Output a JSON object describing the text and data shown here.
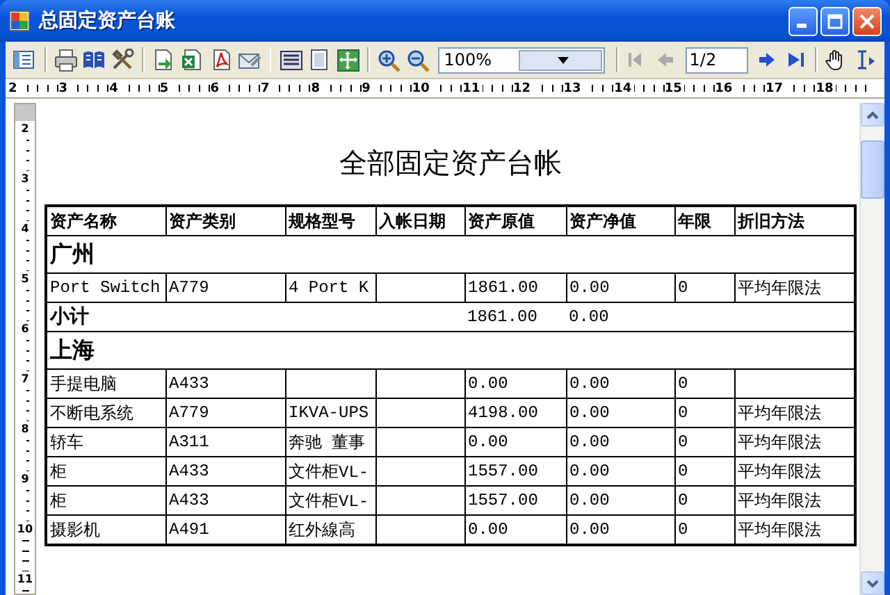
{
  "window": {
    "title": "总固定资产台账"
  },
  "toolbar": {
    "zoom": "100%",
    "page": "1/2"
  },
  "ruler": {
    "horizontal": [
      "2",
      "3",
      "4",
      "5",
      "6",
      "7",
      "8",
      "9",
      "10",
      "11",
      "12",
      "13",
      "14",
      "15",
      "16",
      "17",
      "18"
    ],
    "vertical": [
      "2",
      "3",
      "4",
      "5",
      "6",
      "7",
      "8",
      "9",
      "10",
      "11"
    ]
  },
  "report": {
    "title": "全部固定资产台帐",
    "table": {
      "columns": [
        "资产名称",
        "资产类别",
        "规格型号",
        "入帐日期",
        "资产原值",
        "资产净值",
        "年限",
        "折旧方法"
      ],
      "rows": [
        {
          "kind": "group",
          "label": "广州"
        },
        {
          "kind": "item",
          "cells": [
            "Port Switch",
            "A779",
            "4 Port K",
            null,
            "1861.00",
            "0.00",
            "0",
            "平均年限法"
          ]
        },
        {
          "kind": "subtotal",
          "label": "小计",
          "values": [
            "1861.00",
            "0.00"
          ]
        },
        {
          "kind": "group",
          "label": "上海"
        },
        {
          "kind": "item",
          "cells": [
            "手提电脑",
            "A433",
            null,
            null,
            "0.00",
            "0.00",
            "0",
            null
          ]
        },
        {
          "kind": "item",
          "cells": [
            "不断电系统",
            "A779",
            "IKVA-UPS",
            null,
            "4198.00",
            "0.00",
            "0",
            "平均年限法"
          ]
        },
        {
          "kind": "item",
          "cells": [
            "轿车",
            "A311",
            "奔驰 董事",
            null,
            "0.00",
            "0.00",
            "0",
            "平均年限法"
          ]
        },
        {
          "kind": "item",
          "cells": [
            "柜",
            "A433",
            "文件柜VL-",
            null,
            "1557.00",
            "0.00",
            "0",
            "平均年限法"
          ]
        },
        {
          "kind": "item",
          "cells": [
            "柜",
            "A433",
            "文件柜VL-",
            null,
            "1557.00",
            "0.00",
            "0",
            "平均年限法"
          ]
        },
        {
          "kind": "item",
          "cells": [
            "摄影机",
            "A491",
            "红外線高",
            null,
            "0.00",
            "0.00",
            "0",
            "平均年限法"
          ]
        }
      ]
    }
  }
}
